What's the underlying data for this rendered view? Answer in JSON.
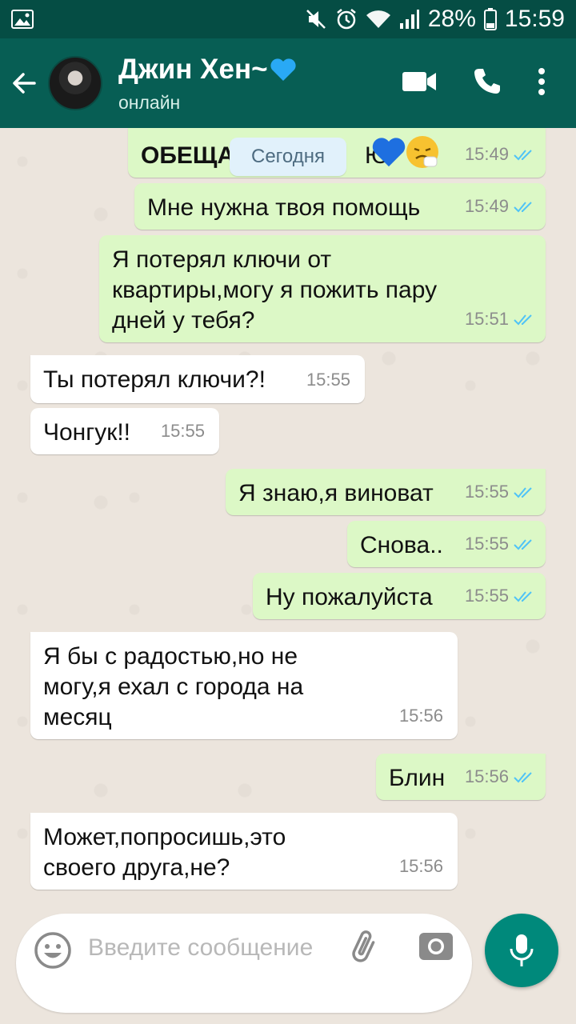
{
  "status_bar": {
    "battery": "28%",
    "time": "15:59"
  },
  "header": {
    "contact_name": "Джин Хен~",
    "contact_status": "онлайн"
  },
  "date_chip": "Сегодня",
  "messages": [
    {
      "text": "ОБЕЩА",
      "trail": "Ю",
      "time": "15:49",
      "dir": "out"
    },
    {
      "text": "Мне нужна твоя помощь",
      "time": "15:49",
      "dir": "out"
    },
    {
      "text": "Я потерял ключи от квартиры,могу я пожить пару дней у тебя?",
      "time": "15:51",
      "dir": "out"
    },
    {
      "text": "Ты потерял ключи?!",
      "time": "15:55",
      "dir": "in"
    },
    {
      "text": "Чонгук!!",
      "time": "15:55",
      "dir": "in"
    },
    {
      "text": "Я знаю,я виноват",
      "time": "15:55",
      "dir": "out"
    },
    {
      "text": "Снова..",
      "time": "15:55",
      "dir": "out"
    },
    {
      "text": "Ну пожалуйста",
      "time": "15:55",
      "dir": "out"
    },
    {
      "text": "Я бы с радостью,но не могу,я ехал с города на месяц",
      "time": "15:56",
      "dir": "in"
    },
    {
      "text": "Блин",
      "time": "15:56",
      "dir": "out"
    },
    {
      "text": "Может,попросишь,это своего друга,не?",
      "time": "15:56",
      "dir": "in"
    }
  ],
  "input": {
    "placeholder": "Введите сообщение"
  },
  "icons": {
    "back": "arrow-left-icon",
    "video": "video-camera-icon",
    "call": "phone-icon",
    "menu": "more-vert-icon",
    "emoji": "emoji-icon",
    "attach": "paperclip-icon",
    "camera": "camera-icon",
    "mic": "microphone-icon",
    "read": "double-check-icon"
  },
  "colors": {
    "header": "#075E54",
    "status_bar": "#054D44",
    "outgoing_bubble": "#DCF8C6",
    "incoming_bubble": "#FFFFFF",
    "read_ticks": "#4FC3F7",
    "mic_button": "#00897B"
  }
}
